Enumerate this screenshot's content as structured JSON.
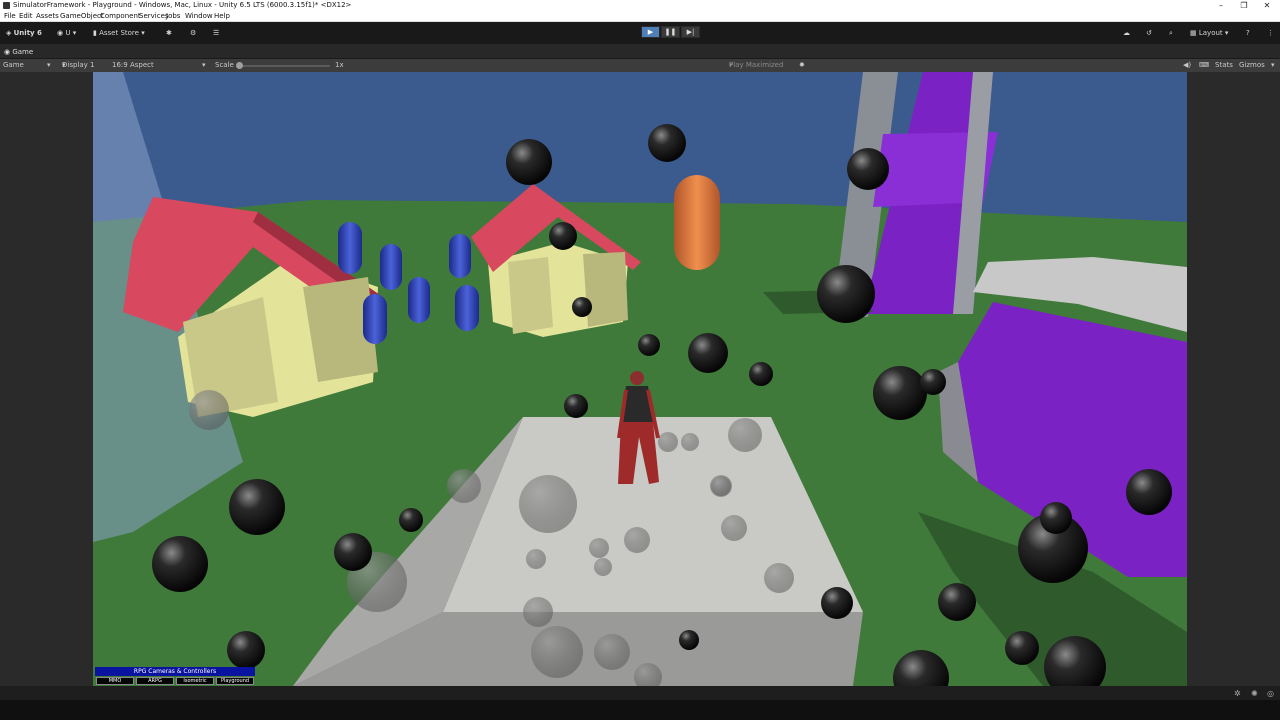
{
  "window": {
    "title": "SimulatorFramework - Playground - Windows, Mac, Linux - Unity 6.5 LTS (6000.3.15f1)* <DX12>",
    "min_glyph": "–",
    "restore_glyph": "❐",
    "close_glyph": "✕"
  },
  "menu": {
    "items": [
      "File",
      "Edit",
      "Assets",
      "GameObject",
      "Component",
      "Services",
      "Jobs",
      "Window",
      "Help"
    ]
  },
  "toolbar": {
    "unity_label": "Unity 6",
    "account_label": "U",
    "asset_store_label": "Asset Store",
    "layout_label": "Layout"
  },
  "play": {
    "play_glyph": "▶",
    "pause_glyph": "❚❚",
    "step_glyph": "▶|"
  },
  "tab": {
    "label": "Game"
  },
  "gamebar": {
    "mode": "Game",
    "display": "Display 1",
    "aspect": "16:9 Aspect",
    "scale_label": "Scale",
    "scale_value": "1x",
    "play_maximized": "Play Maximized",
    "stats": "Stats",
    "gizmos": "Gizmos"
  },
  "rpg_panel": {
    "title": "RPG Cameras & Controllers",
    "buttons": [
      "MMO",
      "ARPG",
      "Isometric",
      "Playground"
    ]
  },
  "colors": {
    "sky": "#3b5b8e",
    "grass": "#3f7a3a",
    "roof": "#d8485f",
    "walls": "#e4e39a",
    "purple": "#7b22c4",
    "blue_capsule": "#2b3fa8",
    "orange_capsule": "#e07a3c",
    "platform": "#c9c9c6"
  }
}
